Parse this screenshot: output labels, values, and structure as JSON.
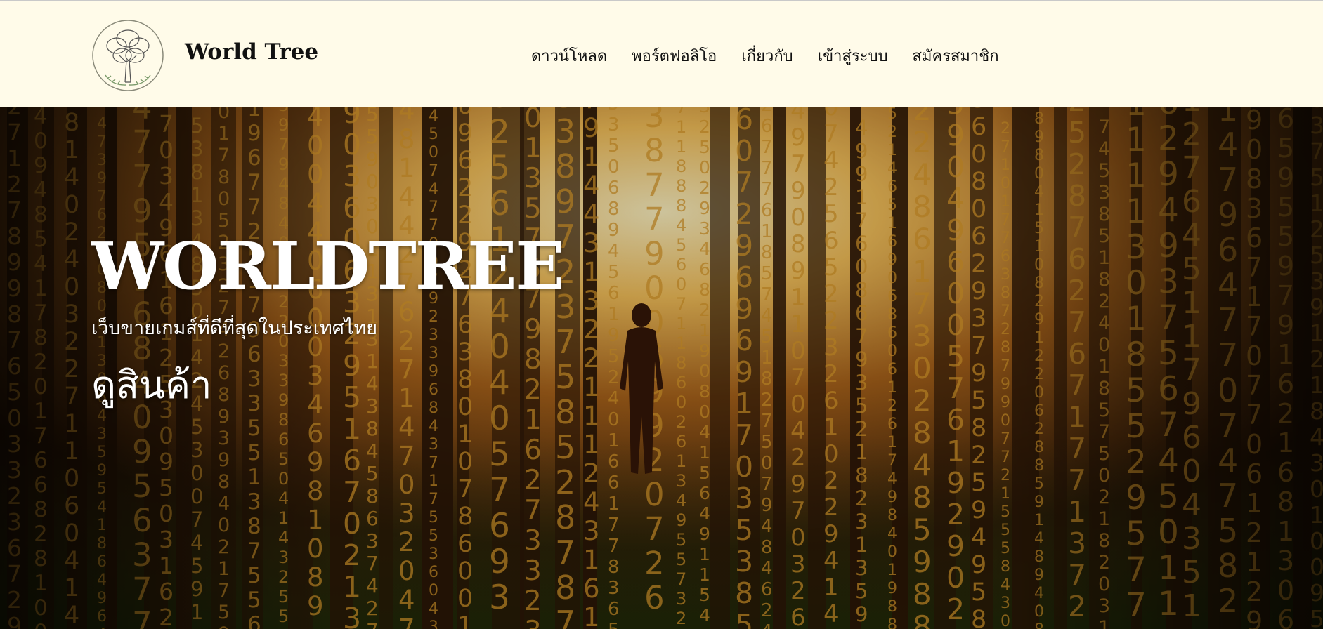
{
  "header": {
    "brand_name": "World Tree",
    "logo_icon": "tree-emblem-icon",
    "nav": [
      {
        "label": "ดาวน์โหลด"
      },
      {
        "label": "พอร์ตฟอลิโอ"
      },
      {
        "label": "เกี่ยวกับ"
      },
      {
        "label": "เข้าสู่ระบบ"
      },
      {
        "label": "สมัครสมาชิก"
      }
    ]
  },
  "hero": {
    "title": "WORLDTREE",
    "subtitle": "เว็บขายเกมส์ที่ดีที่สุดในประเทศไทย",
    "cta_label": "ดูสินค้า",
    "background": "forest-with-walking-person-and-falling-digits"
  },
  "colors": {
    "header_bg": "#fffbe9",
    "text_dark": "#111111",
    "hero_text": "#ffffff",
    "digit_gold": "#d99a2b"
  }
}
